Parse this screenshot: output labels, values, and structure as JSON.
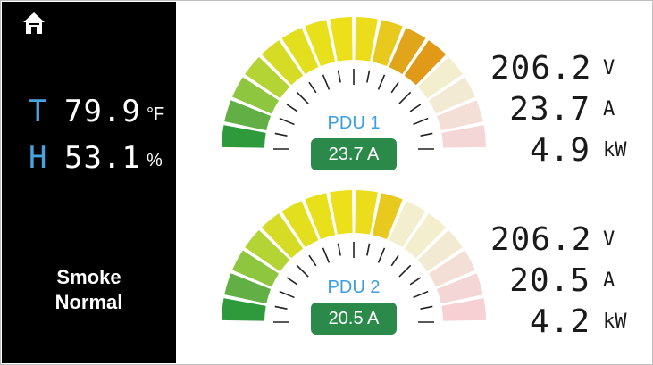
{
  "environment": {
    "home_icon": "home-icon",
    "temperature": {
      "tag": "T",
      "value": "79.9",
      "unit": "°F"
    },
    "humidity": {
      "tag": "H",
      "value": "53.1",
      "unit": "%"
    },
    "smoke": {
      "line1": "Smoke",
      "line2": "Normal"
    }
  },
  "pdus": [
    {
      "name": "PDU 1",
      "current_label": "23.7 A",
      "load_fraction": 0.73,
      "readings": [
        {
          "value": "206.2",
          "unit": "V"
        },
        {
          "value": "23.7",
          "unit": "A"
        },
        {
          "value": "4.9",
          "unit": "kW"
        }
      ]
    },
    {
      "name": "PDU 2",
      "current_label": "20.5 A",
      "load_fraction": 0.6,
      "readings": [
        {
          "value": "206.2",
          "unit": "V"
        },
        {
          "value": "20.5",
          "unit": "A"
        },
        {
          "value": "4.2",
          "unit": "kW"
        }
      ]
    }
  ],
  "colors": {
    "segments": [
      "#2e9a3c",
      "#62b045",
      "#8ec63f",
      "#b4d335",
      "#d6dc26",
      "#e3df1f",
      "#e8e01b",
      "#ece01a",
      "#ebdc1c",
      "#e8c91d",
      "#e0a51a",
      "#e09a18",
      "#f3ecd0",
      "#f4d7d3",
      "#f4d2d2",
      "#f6d0d2"
    ],
    "inactive_left": [
      "#f3efce",
      "#f2ead3",
      "#f4dfd6",
      "#f5d6d6",
      "#f6d0d2"
    ]
  }
}
